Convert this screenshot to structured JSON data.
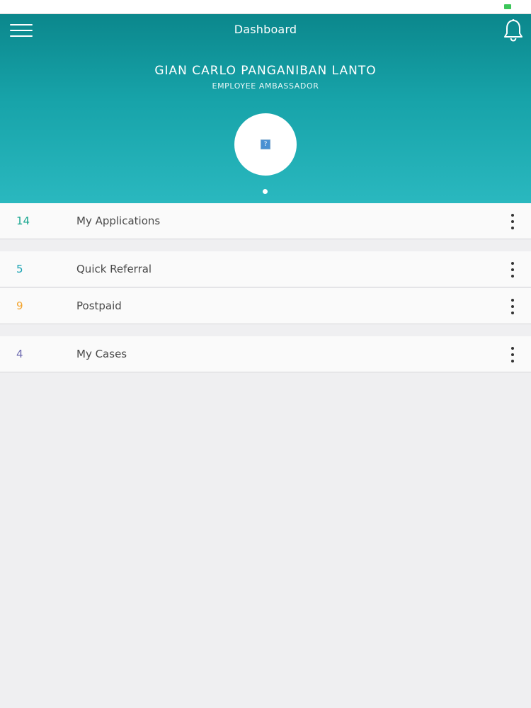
{
  "header": {
    "title": "Dashboard",
    "menu_icon": "hamburger-menu-icon",
    "notification_icon": "bell-icon"
  },
  "profile": {
    "name": "GIAN CARLO PANGANIBAN LANTO",
    "role": "EMPLOYEE AMBASSADOR",
    "avatar_placeholder": "?"
  },
  "list": {
    "items": [
      {
        "count": "14",
        "label": "My Applications",
        "count_color": "#17a68f"
      },
      {
        "count": "5",
        "label": "Quick Referral",
        "count_color": "#1aa3b3"
      },
      {
        "count": "9",
        "label": "Postpaid",
        "count_color": "#f3a530"
      },
      {
        "count": "4",
        "label": "My Cases",
        "count_color": "#6e6bb0"
      }
    ]
  },
  "colors": {
    "header_top": "#0b878c",
    "header_bottom": "#2ab8bf",
    "background": "#efeff1"
  }
}
